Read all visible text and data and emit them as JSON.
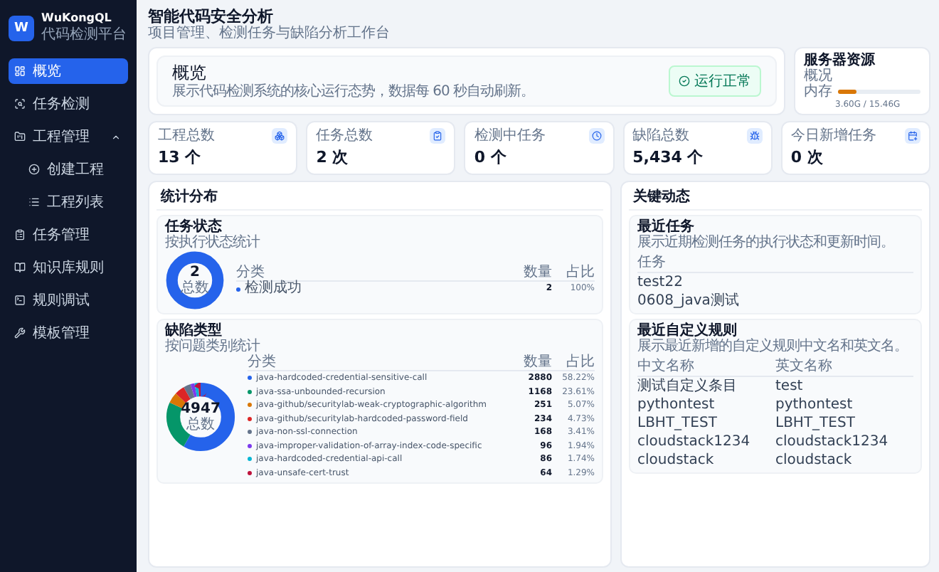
{
  "brand": {
    "logo": "W",
    "name": "WuKongQL",
    "subtitle": "代码检测平台"
  },
  "sidebar": {
    "items": [
      {
        "label": "概览",
        "selected": true
      },
      {
        "label": "任务检测",
        "selected": false
      },
      {
        "label": "工程管理",
        "selected": false,
        "expanded": true,
        "children": [
          {
            "label": "创建工程",
            "selected": false
          },
          {
            "label": "工程列表",
            "selected": false
          }
        ]
      },
      {
        "label": "任务管理",
        "selected": false
      },
      {
        "label": "知识库规则",
        "selected": false
      },
      {
        "label": "规则调试",
        "selected": false
      },
      {
        "label": "模板管理",
        "selected": false
      }
    ]
  },
  "header": {
    "title": "智能代码安全分析",
    "subtitle": "项目管理、检测任务与缺陷分析工作台"
  },
  "overview": {
    "title": "概览",
    "description": "展示代码检测系统的核心运行态势，数据每 60 秒自动刷新。",
    "status": "运行正常"
  },
  "server": {
    "title": "服务器资源",
    "caption": "概况",
    "memory_label": "内存",
    "level": 0.23,
    "reading": "3.60G / 15.46G"
  },
  "stats": [
    {
      "label": "工程总数",
      "value": "13 个"
    },
    {
      "label": "任务总数",
      "value": "2 次"
    },
    {
      "label": "检测中任务",
      "value": "0 个"
    },
    {
      "label": "缺陷总数",
      "value": "5,434 个"
    },
    {
      "label": "今日新增任务",
      "value": "0 次"
    }
  ],
  "distribution": {
    "title": "统计分布",
    "groups": [
      {
        "title": "任务状态",
        "subtitle": "按执行状态统计",
        "total": "2",
        "total_label": "总数",
        "columns": [
          "分类",
          "数量",
          "占比"
        ],
        "rows": [
          {
            "name": "检测成功",
            "count": "2",
            "share": "100%",
            "color": "#2563eb"
          }
        ]
      },
      {
        "title": "缺陷类型",
        "subtitle": "按问题类别统计",
        "total": "4947",
        "total_label": "总数",
        "columns": [
          "分类",
          "数量",
          "占比"
        ],
        "rows": [
          {
            "name": "java-hardcoded-credential-sensitive-call",
            "count": "2880",
            "share": "58.22%",
            "color": "#2563eb"
          },
          {
            "name": "java-ssa-unbounded-recursion",
            "count": "1168",
            "share": "23.61%",
            "color": "#059669"
          },
          {
            "name": "java-github/securitylab-weak-cryptographic-algorithm",
            "count": "251",
            "share": "5.07%",
            "color": "#d97706"
          },
          {
            "name": "java-github/securitylab-hardcoded-password-field",
            "count": "234",
            "share": "4.73%",
            "color": "#dc2626"
          },
          {
            "name": "java-non-ssl-connection",
            "count": "168",
            "share": "3.41%",
            "color": "#64748b"
          },
          {
            "name": "java-improper-validation-of-array-index-code-specific",
            "count": "96",
            "share": "1.94%",
            "color": "#7c3aed"
          },
          {
            "name": "java-hardcoded-credential-api-call",
            "count": "86",
            "share": "1.74%",
            "color": "#06b6d4"
          },
          {
            "name": "java-unsafe-cert-trust",
            "count": "64",
            "share": "1.29%",
            "color": "#be123c"
          }
        ]
      }
    ]
  },
  "activity": {
    "title": "关键动态",
    "recent_tasks": {
      "title": "最近任务",
      "description": "展示近期检测任务的执行状态和更新时间。",
      "columns": [
        "任务"
      ],
      "rows": [
        [
          "test22"
        ],
        [
          "0608_java测试"
        ]
      ]
    },
    "recent_rules": {
      "title": "最近自定义规则",
      "description": "展示最近新增的自定义规则中文名和英文名。",
      "columns": [
        "中文名称",
        "英文名称"
      ],
      "rows": [
        [
          "测试自定义条目",
          "test"
        ],
        [
          "pythontest",
          "pythontest"
        ],
        [
          "LBHT_TEST",
          "LBHT_TEST"
        ],
        [
          "cloudstack1234",
          "cloudstack1234"
        ],
        [
          "cloudstack",
          "cloudstack"
        ]
      ]
    }
  }
}
